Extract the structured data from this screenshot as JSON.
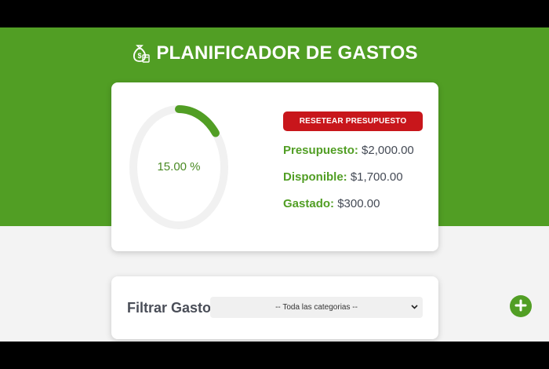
{
  "app": {
    "title": "PLANIFICADOR DE GASTOS",
    "icon": "money-bag-icon"
  },
  "budget": {
    "percent_label": "15.00 %",
    "percent_spent": 15,
    "reset_label": "RESETEAR PRESUPUESTO",
    "stats": [
      {
        "label": "Presupuesto:",
        "value": "$2,000.00"
      },
      {
        "label": "Disponible:",
        "value": "$1,700.00"
      },
      {
        "label": "Gastado:",
        "value": "$300.00"
      }
    ]
  },
  "filter": {
    "label": "Filtrar Gastos",
    "selected": "-- Toda las categorias --"
  },
  "add_button": {
    "icon": "plus-icon"
  },
  "colors": {
    "brand_green": "#519e24",
    "danger_red": "#c8161b",
    "page_bg": "#f3f3f3"
  }
}
